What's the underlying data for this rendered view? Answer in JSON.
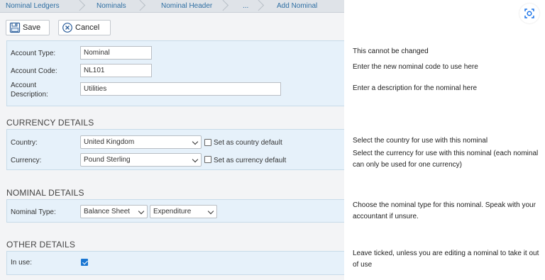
{
  "breadcrumb": [
    "Nominal Ledgers",
    "Nominals",
    "Nominal Header",
    "...",
    "Add Nominal"
  ],
  "toolbar": {
    "save_label": "Save",
    "cancel_label": "Cancel"
  },
  "account": {
    "type_label": "Account Type:",
    "type_value": "Nominal",
    "code_label": "Account Code:",
    "code_value": "NL101",
    "desc_label_line1": "Account",
    "desc_label_line2": "Description:",
    "desc_value": "Utilities"
  },
  "currency_details": {
    "title": "CURRENCY DETAILS",
    "country_label": "Country:",
    "country_value": "United Kingdom",
    "country_default_label": "Set as country default",
    "currency_label": "Currency:",
    "currency_value": "Pound Sterling",
    "currency_default_label": "Set as currency default"
  },
  "nominal_details": {
    "title": "NOMINAL DETAILS",
    "type_label": "Nominal Type:",
    "type_value1": "Balance Sheet",
    "type_value2": "Expenditure"
  },
  "other_details": {
    "title": "OTHER DETAILS",
    "in_use_label": "In use:",
    "in_use_checked": true
  },
  "help": {
    "account_type": "This cannot be changed",
    "account_code": "Enter the new nominal code to use here",
    "account_desc": "Enter a description for the nominal here",
    "country": "Select the country for use with this nominal",
    "currency": "Select the currency for use with this nominal (each nominal can only be used for one currency)",
    "nominal_type": "Choose the nominal type for this nominal. Speak with your accountant if unsure.",
    "in_use": "Leave ticked, unless you are editing a nominal to take it out of use"
  },
  "colors": {
    "panel_bg": "#e6f1fa",
    "link": "#2f6fa3",
    "checkbox_accent": "#1976d2"
  },
  "icons": {
    "save": "floppy-disk-icon",
    "cancel": "circle-x-icon",
    "scan": "scan-lens-icon"
  }
}
